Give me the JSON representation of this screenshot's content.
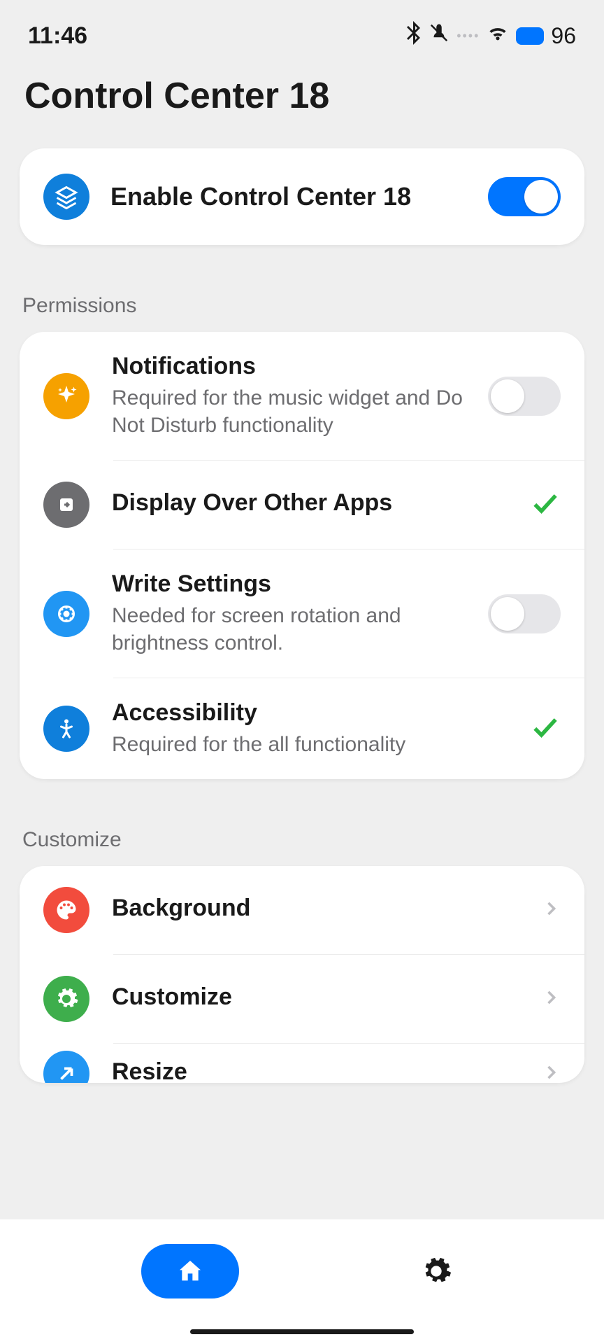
{
  "status": {
    "time": "11:46",
    "battery": "96"
  },
  "title": "Control Center 18",
  "enable": {
    "label": "Enable Control Center 18",
    "on": true
  },
  "sections": {
    "permissions": "Permissions",
    "customize": "Customize"
  },
  "permissions": [
    {
      "title": "Notifications",
      "subtitle": "Required for the music widget and Do Not Disturb functionality",
      "icon": "sparkle",
      "color": "#F6A100",
      "state": "toggle-off"
    },
    {
      "title": "Display Over Other Apps",
      "subtitle": "",
      "icon": "overlay",
      "color": "#6d6d70",
      "state": "check"
    },
    {
      "title": "Write Settings",
      "subtitle": "Needed for screen rotation and brightness control.",
      "icon": "gear",
      "color": "#2196F3",
      "state": "toggle-off"
    },
    {
      "title": "Accessibility",
      "subtitle": "Required for the all functionality",
      "icon": "person",
      "color": "#0F7FDB",
      "state": "check"
    }
  ],
  "customize": [
    {
      "title": "Background",
      "icon": "palette",
      "color": "#F24C3D"
    },
    {
      "title": "Customize",
      "icon": "cog",
      "color": "#3EAE4C"
    },
    {
      "title": "Resize",
      "icon": "arrow",
      "color": "#2196F3"
    }
  ]
}
